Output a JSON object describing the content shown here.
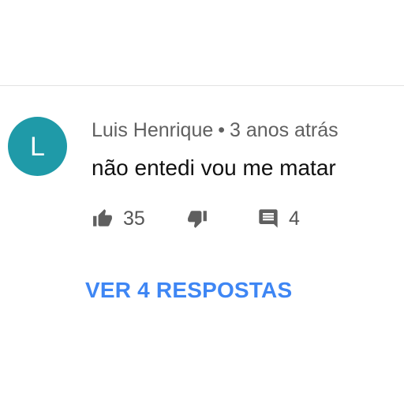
{
  "comment": {
    "avatar_initial": "L",
    "avatar_color": "#1f9aa8",
    "author": "Luis Henrique",
    "separator": "•",
    "timestamp": "3 anos atrás",
    "text": "não entedi vou me matar",
    "likes": "35",
    "replies_count": "4",
    "view_replies_label": "VER 4 RESPOSTAS",
    "link_color": "#3e86f4",
    "icon_color": "#5f5f5f"
  },
  "icons": {
    "like": "thumbs-up-icon",
    "dislike": "thumbs-down-icon",
    "reply": "comment-icon"
  }
}
